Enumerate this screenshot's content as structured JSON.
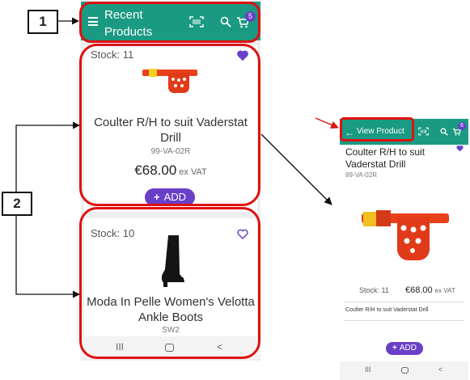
{
  "callouts": {
    "one": "1",
    "two": "2"
  },
  "left_screen": {
    "title": "Recent Products",
    "cart_count": "5",
    "products": [
      {
        "stock": "Stock: 11",
        "name": "Coulter R/H to suit Vaderstat Drill",
        "sku": "99-VA-02R",
        "price": "€68.00",
        "vat": "ex VAT",
        "add": "ADD",
        "favourite": true
      },
      {
        "stock": "Stock: 10",
        "name": "Moda In Pelle Women's Velotta Ankle Boots",
        "sku": "SW2",
        "favourite": false
      }
    ],
    "nav": {
      "recent": "III",
      "back": "<"
    }
  },
  "right_screen": {
    "title": "View Product",
    "back_icon": "←",
    "cart_count": "6",
    "name": "Coulter R/H to suit Vaderstat Drill",
    "sku": "99-VA-02R",
    "stock": "Stock: 11",
    "price": "€68.00",
    "vat": "ex VAT",
    "description": "Coulter R/H to suit Vaderstat Drill",
    "add": "ADD",
    "nav": {
      "recent": "III",
      "back": "<"
    }
  },
  "colors": {
    "header": "#1a9a82",
    "accent": "#6a3fc8",
    "annotation": "#e01010",
    "product_red": "#e8401a"
  },
  "icons": [
    "menu-icon",
    "barcode-scan-icon",
    "search-icon",
    "cart-icon",
    "heart-icon",
    "back-arrow-icon",
    "plus-icon"
  ]
}
